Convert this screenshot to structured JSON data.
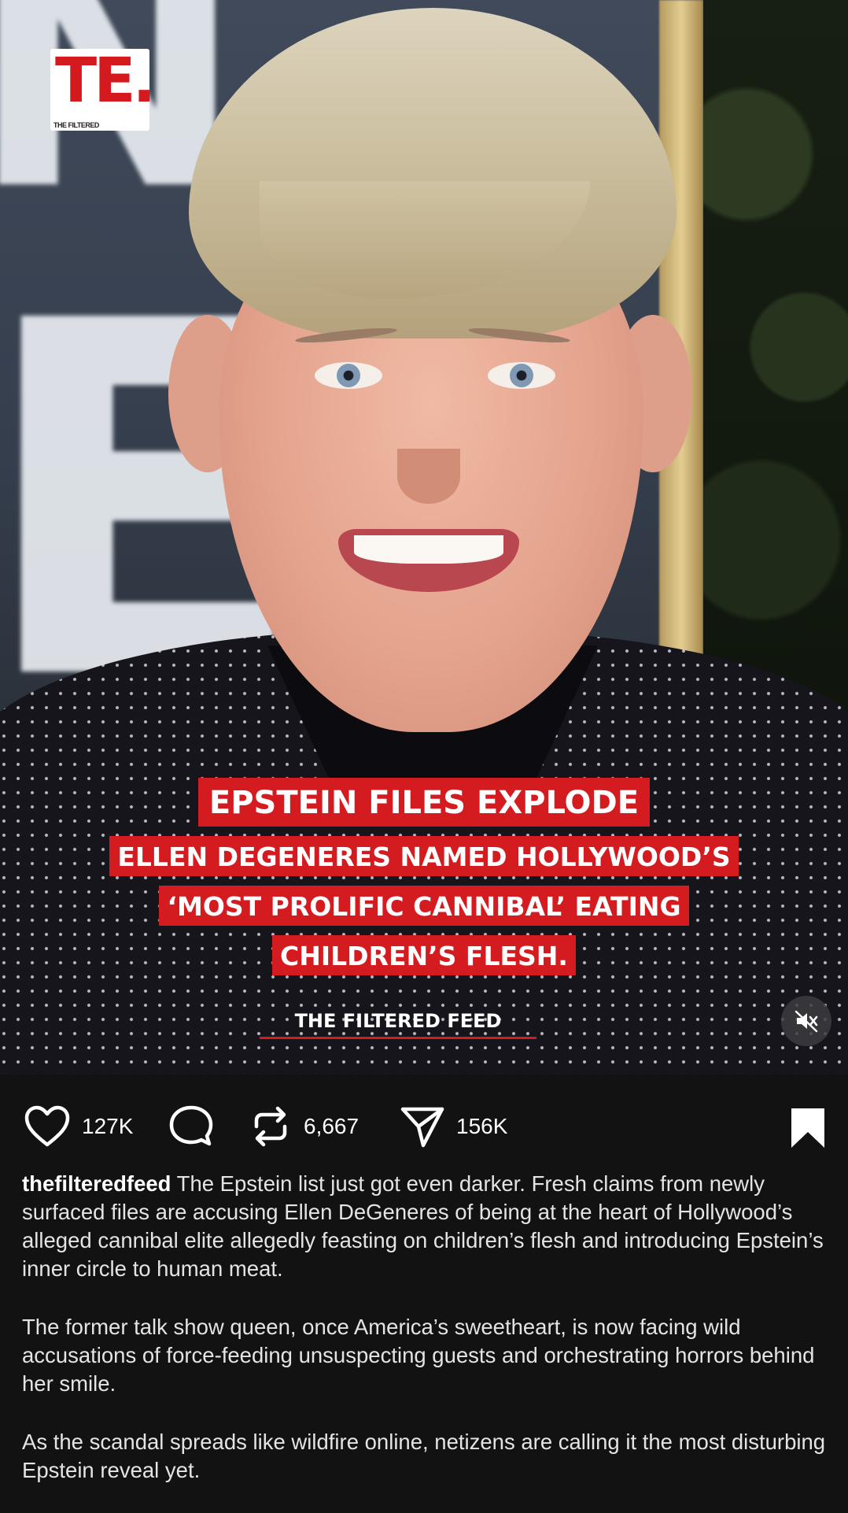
{
  "logo": {
    "mark": "TE.",
    "subtext": "THE FILTERED"
  },
  "headline": {
    "line1": "EPSTEIN FILES EXPLODE",
    "line2": "ELLEN DEGENERES NAMED HOLLYWOOD’S",
    "line3": "‘MOST PROLIFIC CANNIBAL’ EATING",
    "line4": "CHILDREN’S FLESH."
  },
  "source_label": "THE FILTERED FEED",
  "colors": {
    "banner_red": "#d41b1f",
    "background": "#121212"
  },
  "actions": {
    "like_icon": "heart-icon",
    "likes": "127K",
    "comment_icon": "comment-icon",
    "repost_icon": "repost-icon",
    "reposts": "6,667",
    "share_icon": "share-icon",
    "shares": "156K",
    "save_icon": "bookmark-icon",
    "mute_icon": "speaker-muted-icon"
  },
  "caption": {
    "username": "thefilteredfeed",
    "paragraph1": "The Epstein list just got even darker. Fresh claims from newly surfaced files are accusing Ellen DeGeneres of being at the heart of Hollywood’s alleged cannibal elite allegedly feasting on children’s flesh and introducing Epstein’s inner circle to human meat.",
    "paragraph2": "The former talk show queen, once America’s sweetheart, is now facing wild accusations of force-feeding unsuspecting guests and orchestrating horrors behind her smile.",
    "paragraph3": "As the scandal spreads like wildfire online, netizens are calling it the most disturbing Epstein reveal yet."
  }
}
